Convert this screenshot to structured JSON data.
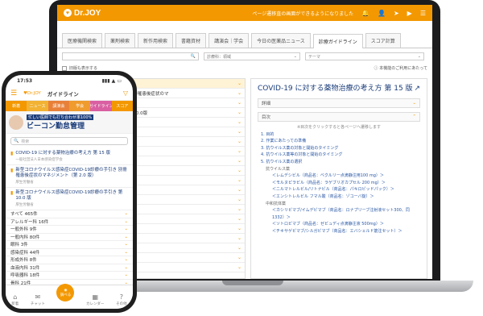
{
  "laptop": {
    "logo": "Dr.JOY",
    "notice": "ページ遷移直の画面ができるようになりました",
    "top_icons": [
      "bell-icon",
      "person-icon",
      "send-icon",
      "video-icon",
      "menu-icon"
    ],
    "tabs": [
      "医療機関検索",
      "薬剤検索",
      "新作用検索",
      "書籍資材",
      "講演会｜学会",
      "今日の医薬品ニュース",
      "診療ガイドライン",
      "スコア計算"
    ],
    "active_tab": 6,
    "filters": [
      {
        "label": "",
        "placeholder": ""
      },
      {
        "label": "診療科：領域",
        "placeholder": ""
      },
      {
        "label": "",
        "placeholder": "テーマ"
      }
    ],
    "checkbox_label": "旧版も表示する",
    "right_link": "本機能のご利用にあたって",
    "left_rows": [
      {
        "text": "する薬物治療の考え方 第15版",
        "hl": true
      },
      {
        "text": "感染症COVID-19診療の手引き 別冊罹患後症状のマ",
        "hl": false
      },
      {
        "text": "版",
        "hl": false
      },
      {
        "text": "感染症COVID-19診療の手引き 第10.0版",
        "hl": false
      },
      {
        "text": "",
        "hl": false
      },
      {
        "text": "",
        "hl": false
      },
      {
        "text": "",
        "hl": false
      },
      {
        "text": "",
        "hl": false
      },
      {
        "text": "",
        "hl": false
      },
      {
        "text": "",
        "hl": false
      },
      {
        "text": "",
        "hl": false
      },
      {
        "text": "",
        "hl": false
      },
      {
        "text": "",
        "hl": false
      },
      {
        "text": "",
        "hl": false
      },
      {
        "text": "",
        "hl": false
      },
      {
        "text": "",
        "hl": false
      },
      {
        "text": "",
        "hl": false
      },
      {
        "text": "",
        "hl": false
      },
      {
        "text": "",
        "hl": false
      },
      {
        "text": "",
        "hl": false
      }
    ],
    "right_title": "COVID-19 に対する薬物治療の考え方 第 15 版",
    "sections": [
      "詳細",
      "目次"
    ],
    "toc_note": "※目次をクリックすると各ページへ遷移します",
    "toc": [
      {
        "text": "1. 目的",
        "cls": ""
      },
      {
        "text": "2. 作業にあたっての準備",
        "cls": ""
      },
      {
        "text": "3. 抗ウイルス薬の対象と開始のタイミング",
        "cls": ""
      },
      {
        "text": "4. 抗ウイルス薬等の対象と開始のタイミング",
        "cls": ""
      },
      {
        "text": "5. 抗ウイルス薬の選択",
        "cls": ""
      },
      {
        "text": "抗ウイルス薬",
        "cls": "sub"
      },
      {
        "text": "＜レムデシビル（商品名：ベクルリー点滴静注用100 mg）＞",
        "cls": "ind"
      },
      {
        "text": "＜モルヌピラビル（商品名：ラゲブリオカプセル 200 mg）＞",
        "cls": "ind"
      },
      {
        "text": "＜ニルマトレルビル/リトナビル（商品名：パキロビッドパック）＞",
        "cls": "ind"
      },
      {
        "text": "＜エンシトレルビル フマル酸（商品名：ゾコーバ錠）＞",
        "cls": "ind"
      },
      {
        "text": "中和抗体薬",
        "cls": "sub"
      },
      {
        "text": "＜カシリビマブ/イムデビマブ（商品名：ロナプリーブ注射液セット300、同1332）＞",
        "cls": "ind"
      },
      {
        "text": "＜ソトロビマブ（商品名：ゼビュディ点滴静注液 500mg）＞",
        "cls": "ind"
      },
      {
        "text": "＜チキサゲビマブ/シルガビマブ（商品名：エバシェルド筋注セット）＞",
        "cls": "ind"
      }
    ]
  },
  "phone": {
    "time": "17:53",
    "status_icons": "▮▮▮ ▲ ▭",
    "header_title": "ガイドライン",
    "tabs": [
      {
        "label": "新着",
        "color": "#f39800"
      },
      {
        "label": "ニュース",
        "color": "#f2b233"
      },
      {
        "label": "講演会",
        "color": "#e8803a"
      },
      {
        "label": "学会",
        "color": "#ef9b2d"
      },
      {
        "label": "ガイドライン",
        "color": "#d95fa2"
      },
      {
        "label": "スコア",
        "color": "#f39800"
      }
    ],
    "banner_small": "忙しい医師でも打ち合わせ率100%",
    "banner_big": "ビーコン勤怠管理",
    "search_placeholder": "検索",
    "items": [
      {
        "title": "COVID-19 に対する薬物治療の考え方 第 15 版",
        "sub": "一般社団法人日本感染症学会"
      },
      {
        "title": "新型コロナウイルス感染症COVID-19診療の手引き 別冊罹患後症状のマネジメント（第 2.0 版）",
        "sub": "厚生労働省"
      },
      {
        "title": "新型コロナウイルス感染症COVID-19診療の手引き 第10.0 版",
        "sub": "厚生労働省"
      }
    ],
    "categories": [
      {
        "name": "すべて",
        "count": "465件"
      },
      {
        "name": "アレルギー科",
        "count": "16件"
      },
      {
        "name": "一般外科",
        "count": "9件"
      },
      {
        "name": "一般内科",
        "count": "80件"
      },
      {
        "name": "眼科",
        "count": "3件"
      },
      {
        "name": "感染症科",
        "count": "44件"
      },
      {
        "name": "形成外科",
        "count": "8件"
      },
      {
        "name": "血液内科",
        "count": "31件"
      },
      {
        "name": "呼吸器科",
        "count": "18件"
      },
      {
        "name": "骨科",
        "count": "21件"
      }
    ],
    "nav": [
      {
        "label": "新着",
        "icon": "⌂"
      },
      {
        "label": "チャット",
        "icon": "✉"
      },
      {
        "label": "調べる",
        "icon": "◉"
      },
      {
        "label": "カレンダー",
        "icon": "▦"
      },
      {
        "label": "その他",
        "icon": "?"
      }
    ]
  }
}
